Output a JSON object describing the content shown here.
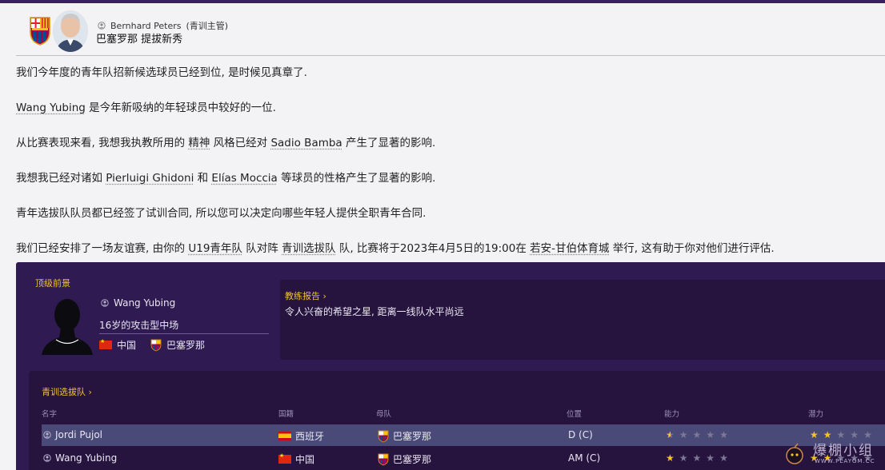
{
  "header": {
    "sender_name": "Bernhard Peters",
    "sender_role": "(青训主管)",
    "subject": "巴塞罗那 提拔新秀"
  },
  "message": {
    "p1": "我们今年度的青年队招新候选球员已经到位, 是时候见真章了.",
    "p2_player": "Wang Yubing",
    "p2_rest": " 是今年新吸纳的年轻球员中较好的一位.",
    "p3_pre": "从比赛表现来看, 我想我执教所用的 ",
    "p3_link": "精神",
    "p3_mid": " 风格已经对 ",
    "p3_player": "Sadio Bamba",
    "p3_post": " 产生了显著的影响.",
    "p4_pre": "我想我已经对诸如 ",
    "p4_player1": "Pierluigi Ghidoni",
    "p4_and": " 和 ",
    "p4_player2": "Elías Moccia",
    "p4_post": " 等球员的性格产生了显著的影响.",
    "p5": "青年选拔队队员都已经签了试训合同, 所以您可以决定向哪些年轻人提供全职青年合同.",
    "p6_pre": "我们已经安排了一场友谊赛, 由你的 ",
    "p6_team1": "U19青年队",
    "p6_vs": " 队对阵 ",
    "p6_team2": "青训选拔队",
    "p6_mid": " 队, 比赛将于2023年4月5日的19:00在 ",
    "p6_venue": "若安-甘伯体育城",
    "p6_post": " 举行, 这有助于你对他们进行评估."
  },
  "profile": {
    "section_title": "顶级前景",
    "name": "Wang Yubing",
    "desc": "16岁的攻击型中场",
    "nationality": "中国",
    "club": "巴塞罗那"
  },
  "report": {
    "title": "教练报告 ›",
    "text": "令人兴奋的希望之星, 距离一线队水平尚远"
  },
  "squad": {
    "title": "青训选拔队 ›",
    "columns": {
      "name": "名字",
      "nationality": "国籍",
      "parent_team": "母队",
      "position": "位置",
      "ability": "能力",
      "potential": "潜力"
    },
    "rows": [
      {
        "name": "Jordi Pujol",
        "nationality": "西班牙",
        "club": "巴塞罗那",
        "position": "D (C)",
        "ability": 0.5,
        "potential": 2
      },
      {
        "name": "Wang Yubing",
        "nationality": "中国",
        "club": "巴塞罗那",
        "position": "AM (C)",
        "ability": 1,
        "potential": 2
      }
    ]
  },
  "watermark": {
    "text": "爆棚小组",
    "url": "WWW.PLAYGM.CC"
  },
  "colors": {
    "panel_bg": "#2f1a52",
    "accent_gold": "#f2c230",
    "selected_row": "#4a4a78"
  }
}
